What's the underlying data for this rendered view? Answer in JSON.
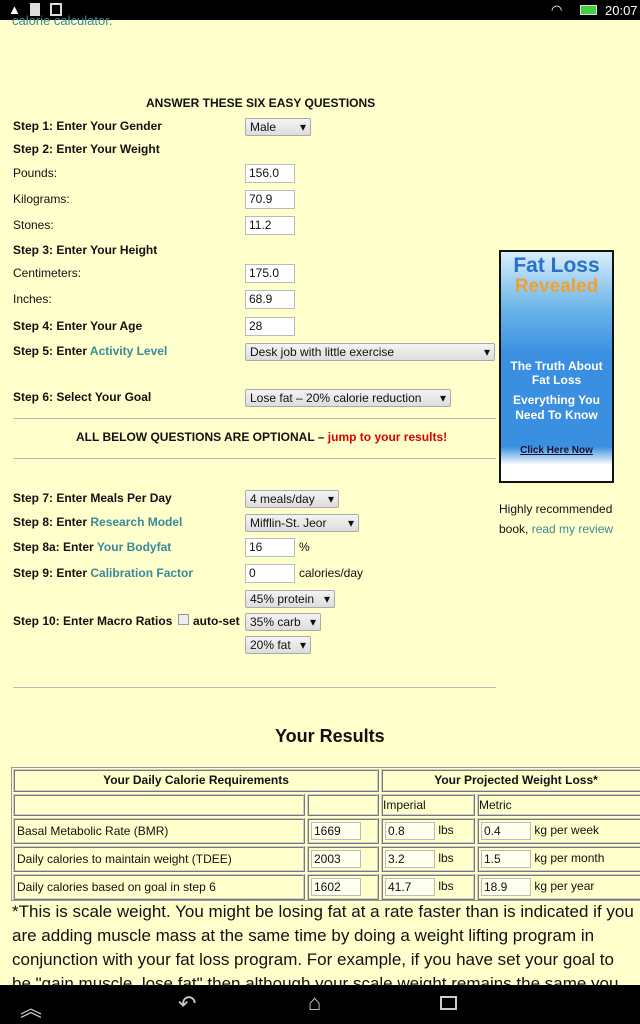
{
  "status_bar": {
    "time": "20:07",
    "left_icons": [
      "warning-icon",
      "sd-card-icon",
      "shopping-bag-icon"
    ],
    "right_icons": [
      "wifi-icon",
      "battery-icon"
    ]
  },
  "top_link": "calorie calculator.",
  "heading": "ANSWER THESE SIX EASY QUESTIONS",
  "steps": {
    "s1": "Step 1: Enter Your Gender",
    "gender": "Male",
    "s2": "Step 2: Enter Your Weight",
    "pounds_label": "Pounds:",
    "pounds": "156.0",
    "kg_label": "Kilograms:",
    "kg": "70.9",
    "stones_label": "Stones:",
    "stones": "11.2",
    "s3": "Step 3: Enter Your Height",
    "cm_label": "Centimeters:",
    "cm": "175.0",
    "in_label": "Inches:",
    "in": "68.9",
    "s4": "Step 4: Enter Your Age",
    "age": "28",
    "s5": "Step 5: Enter ",
    "s5_link": "Activity Level",
    "activity": "Desk job with little exercise",
    "s6": "Step 6: Select Your Goal",
    "goal": "Lose fat – 20% calorie reduction",
    "optional": "ALL BELOW QUESTIONS ARE OPTIONAL – ",
    "optional_link": "jump to your results!",
    "s7": "Step 7: Enter Meals Per Day",
    "meals": "4 meals/day",
    "s8": "Step 8: Enter ",
    "s8_link": "Research Model",
    "model": "Mifflin-St. Jeor",
    "s8a": "Step 8a: Enter ",
    "s8a_link": "Your Bodyfat",
    "bodyfat": "16",
    "bodyfat_unit": "%",
    "s9": "Step 9: Enter ",
    "s9_link": "Calibration Factor",
    "calibration": "0",
    "calibration_unit": "calories/day",
    "s10": "Step 10: Enter Macro Ratios",
    "autoset": "auto-set",
    "protein": "45% protein",
    "carb": "35% carb",
    "fat": "20% fat"
  },
  "ad": {
    "title1": "Fat Loss",
    "title2": "Revealed",
    "line1": "The Truth About Fat Loss",
    "line2": "Everything You Need To Know",
    "cta": "Click Here Now",
    "caption": "Highly recommended book, ",
    "caption_link": "read my review"
  },
  "results": {
    "title": "Your Results",
    "h_left": "Your Daily Calorie Requirements",
    "h_right": "Your Projected Weight Loss*",
    "imperial": "Imperial",
    "metric": "Metric",
    "rows": [
      {
        "label": "Basal Metabolic Rate (BMR)",
        "cal": "1669",
        "lbs": "0.8",
        "lbs_unit": "lbs",
        "kg": "0.4",
        "kg_unit": "kg per week"
      },
      {
        "label": "Daily calories to maintain weight (TDEE)",
        "cal": "2003",
        "lbs": "3.2",
        "lbs_unit": "lbs",
        "kg": "1.5",
        "kg_unit": "kg per month"
      },
      {
        "label": "Daily calories based on goal in step 6",
        "cal": "1602",
        "lbs": "41.7",
        "lbs_unit": "lbs",
        "kg": "18.9",
        "kg_unit": "kg per year"
      }
    ],
    "footnote": "*This is scale weight. You might be losing fat at a rate faster than is indicated if you are adding muscle mass at the same time by doing a weight lifting program in conjunction with your fat loss program. For example, if you have set your goal to be \"gain muscle, lose fat\" then although your scale weight remains the same you can be"
  },
  "nav_icons": [
    "recent-up-icon",
    "back-icon",
    "home-icon",
    "recent-apps-icon"
  ]
}
